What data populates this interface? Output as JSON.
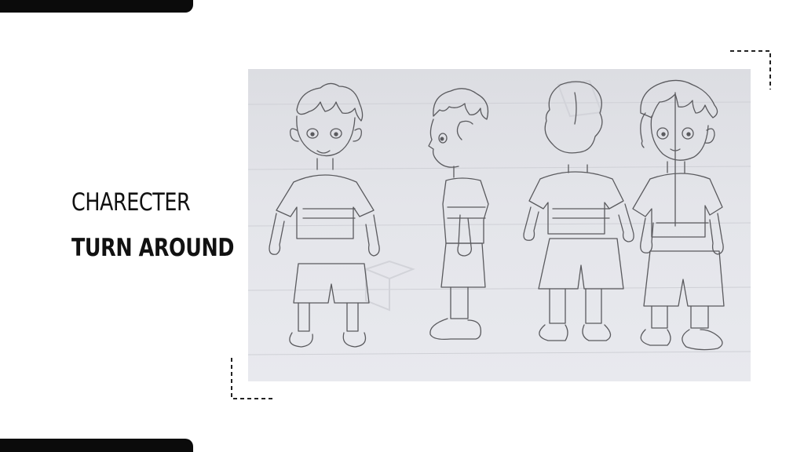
{
  "title": {
    "line1": "CHARECTER",
    "line2": "TURN AROUND"
  },
  "colors": {
    "accent": "#0b0b0b",
    "text": "#111111",
    "paper": "#e2e3e8",
    "pencil": "#5a5a5e"
  },
  "artwork": {
    "subject": "pencil sketch of a boy character in four views: front, side, back, three-quarter"
  }
}
